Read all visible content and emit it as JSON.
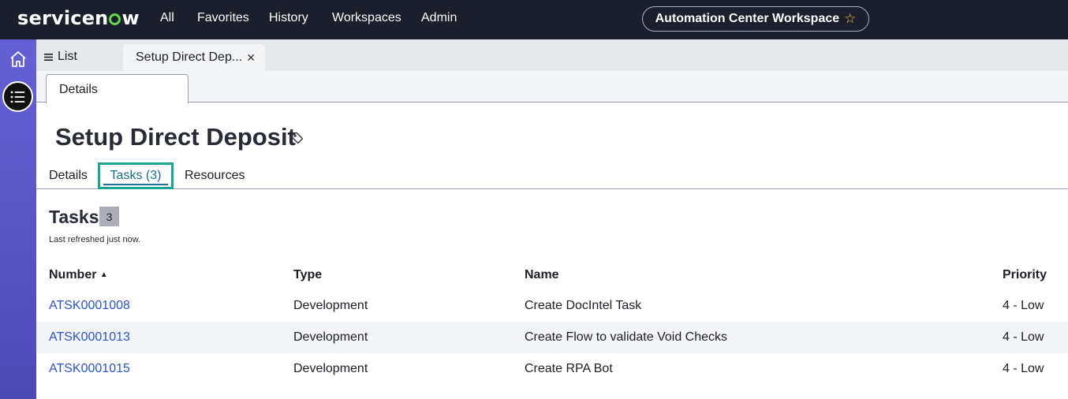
{
  "topnav": {
    "logo_left": "servicen",
    "logo_right": "w",
    "items": [
      "All",
      "Favorites",
      "History",
      "Workspaces",
      "Admin"
    ],
    "workspace": "Automation Center Workspace"
  },
  "tabs": {
    "list_label": "List",
    "record_label": "Setup Direct Dep..."
  },
  "subtab": {
    "label": "Details"
  },
  "record": {
    "title": "Setup Direct Deposit",
    "tabs": [
      "Details",
      "Tasks (3)",
      "Resources"
    ],
    "active_tab": "Tasks (3)"
  },
  "tasks": {
    "heading": "Tasks",
    "count": "3",
    "refreshed": "Last refreshed just now.",
    "columns": [
      "Number",
      "Type",
      "Name",
      "Priority"
    ],
    "sort_indicator": "▲",
    "rows": [
      {
        "number": "ATSK0001008",
        "type": "Development",
        "name": "Create DocIntel Task",
        "priority": "4 - Low"
      },
      {
        "number": "ATSK0001013",
        "type": "Development",
        "name": "Create Flow to validate Void Checks",
        "priority": "4 - Low"
      },
      {
        "number": "ATSK0001015",
        "type": "Development",
        "name": "Create RPA Bot",
        "priority": "4 - Low"
      }
    ]
  },
  "colors": {
    "topbar": "#1b1e2b",
    "rail": "#5a57c8",
    "link": "#2b55c9",
    "active_tab_border": "#1aa58e",
    "logo_accent": "#62d84e"
  }
}
